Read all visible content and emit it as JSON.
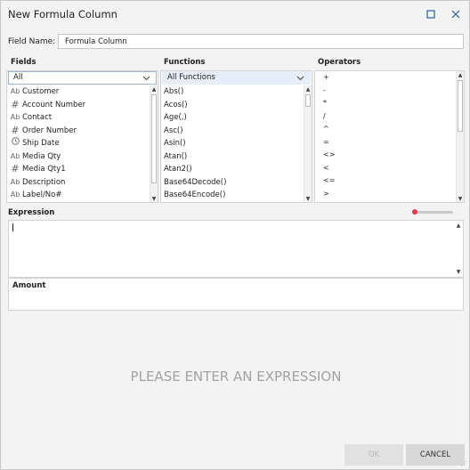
{
  "window": {
    "title": "New Formula Column",
    "maximize_icon": "maximize-icon",
    "close_icon": "close-icon"
  },
  "field_name": {
    "label": "Field Name:",
    "value": "Formula Column"
  },
  "fields": {
    "header": "Fields",
    "filter_selected": "All",
    "items": [
      {
        "type_icon": "Ab",
        "label": "Customer"
      },
      {
        "type_icon": "#",
        "label": "Account Number"
      },
      {
        "type_icon": "Ab",
        "label": "Contact"
      },
      {
        "type_icon": "#",
        "label": "Order Number"
      },
      {
        "type_icon": "clock-icon",
        "label": "Ship Date"
      },
      {
        "type_icon": "Ab",
        "label": "Media Qty"
      },
      {
        "type_icon": "#",
        "label": "Media Qty1"
      },
      {
        "type_icon": "Ab",
        "label": "Description"
      },
      {
        "type_icon": "Ab",
        "label": "Label/No#"
      }
    ]
  },
  "functions": {
    "header": "Functions",
    "filter_selected": "All Functions",
    "items": [
      "Abs()",
      "Acos()",
      "Age(,)",
      "Asc()",
      "Asin()",
      "Atan()",
      "Atan2()",
      "Base64Decode()",
      "Base64Encode()"
    ]
  },
  "operators": {
    "header": "Operators",
    "items": [
      "+",
      "-",
      "*",
      "/",
      "^",
      "=",
      "<>",
      "<",
      "<=",
      ">"
    ]
  },
  "expression": {
    "header": "Expression",
    "value": ""
  },
  "result": {
    "label": "Amount"
  },
  "message": "PLEASE ENTER AN EXPRESSION",
  "buttons": {
    "ok": "OK",
    "cancel": "CANCEL"
  },
  "colors": {
    "accent": "#2c5f9e",
    "slider": "#e53950",
    "selection_bg": "#e6eef9"
  }
}
